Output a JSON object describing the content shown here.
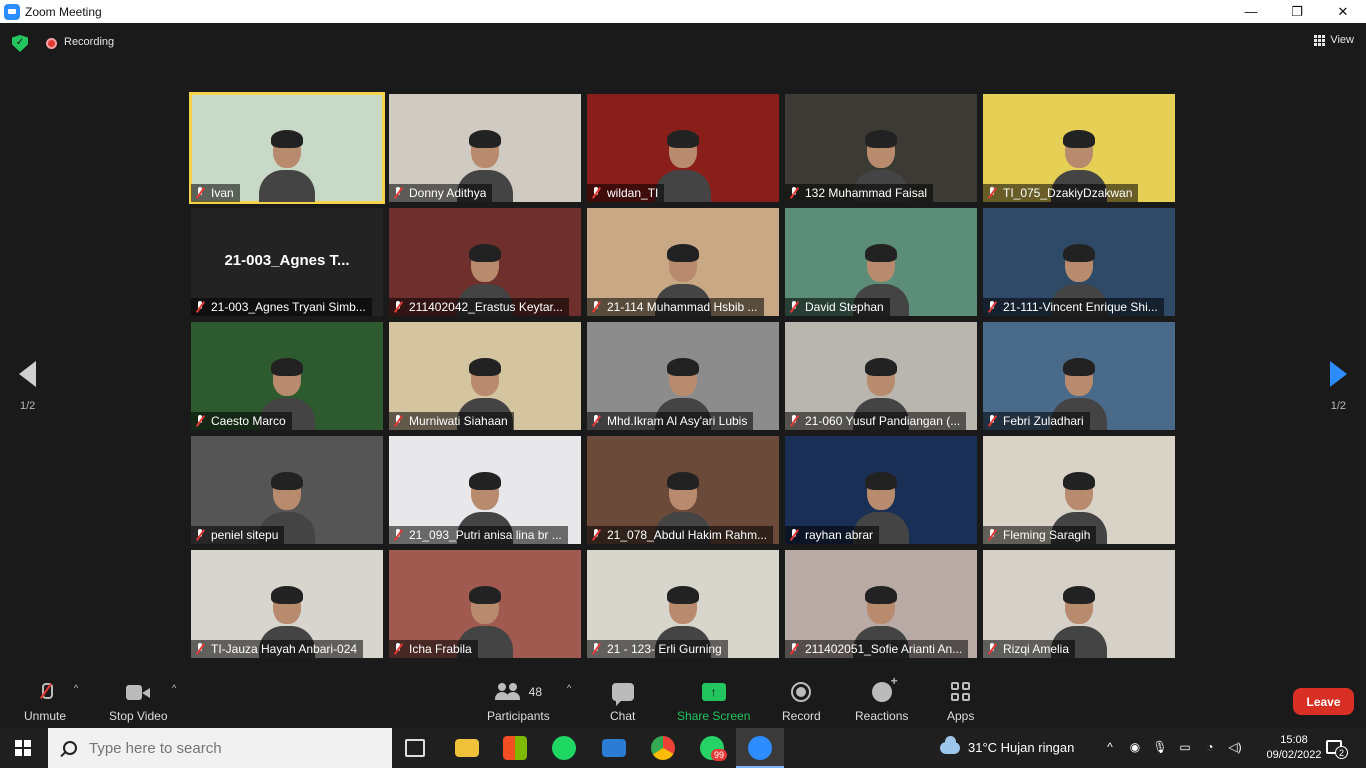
{
  "window": {
    "title": "Zoom Meeting",
    "minimize": "—",
    "maximize": "❐",
    "close": "✕"
  },
  "meeting_bar": {
    "recording_label": "Recording",
    "view_label": "View"
  },
  "pagination": {
    "left": "1/2",
    "right": "1/2"
  },
  "participants": [
    {
      "name": "Ivan",
      "bg": "#c9d9c7",
      "active": true
    },
    {
      "name": "Donny Adithya",
      "bg": "#cfcac2"
    },
    {
      "name": "wildan_TI",
      "bg": "#8a1e1a"
    },
    {
      "name": "132 Muhammad Faisal",
      "bg": "#3b3a35"
    },
    {
      "name": "TI_075_DzakiyDzakwan",
      "bg": "#e6cf55"
    },
    {
      "name": "21-003_Agnes Tryani Simb...",
      "bg": "#232323",
      "bigname": "21-003_Agnes T..."
    },
    {
      "name": "211402042_Erastus Keytar...",
      "bg": "#6e2f2d"
    },
    {
      "name": "21-114 Muhammad Hsbib ...",
      "bg": "#c8a885"
    },
    {
      "name": "David Stephan",
      "bg": "#5b8d78"
    },
    {
      "name": "21-111-Vincent Enrique Shi...",
      "bg": "#2f4a66"
    },
    {
      "name": "Caesto Marco",
      "bg": "#2e5a2f"
    },
    {
      "name": "Murniwati Siahaan",
      "bg": "#d4c4a0"
    },
    {
      "name": "Mhd.Ikram Al Asy'ari Lubis",
      "bg": "#8c8c8c"
    },
    {
      "name": "21-060 Yusuf Pandiangan (...",
      "bg": "#b8b6ae"
    },
    {
      "name": "Febri Zuladhari",
      "bg": "#4a6a8a"
    },
    {
      "name": "peniel sitepu",
      "bg": "#555555"
    },
    {
      "name": "21_093_Putri anisa lina br ...",
      "bg": "#e8e8ea"
    },
    {
      "name": "21_078_Abdul Hakim Rahm...",
      "bg": "#6b4a3a"
    },
    {
      "name": "rayhan abrar",
      "bg": "#1a2f55"
    },
    {
      "name": "Fleming Saragih",
      "bg": "#d9d2c6"
    },
    {
      "name": "TI-Jauza Hayah Anbari-024",
      "bg": "#d8d4ce"
    },
    {
      "name": "Icha Frabila",
      "bg": "#a05a50"
    },
    {
      "name": "21 - 123- Erli Gurning",
      "bg": "#d7d5cc"
    },
    {
      "name": "211402051_Sofie Arianti An...",
      "bg": "#b9aaa6"
    },
    {
      "name": "Rizqi Amelia",
      "bg": "#d6d1c8"
    }
  ],
  "controls": {
    "unmute": "Unmute",
    "stop_video": "Stop Video",
    "participants": "Participants",
    "participants_count": "48",
    "chat": "Chat",
    "share_screen": "Share Screen",
    "record": "Record",
    "reactions": "Reactions",
    "apps": "Apps",
    "leave": "Leave"
  },
  "taskbar": {
    "search_placeholder": "Type here to search",
    "whatsapp_badge": "99",
    "weather": "31°C  Hujan ringan",
    "time": "15:08",
    "date": "09/02/2022",
    "notifications": "2"
  },
  "colors": {
    "accent": "#2d8cff",
    "share_green": "#23c55e",
    "leave_red": "#d93025",
    "active_border": "#f4d24a"
  }
}
